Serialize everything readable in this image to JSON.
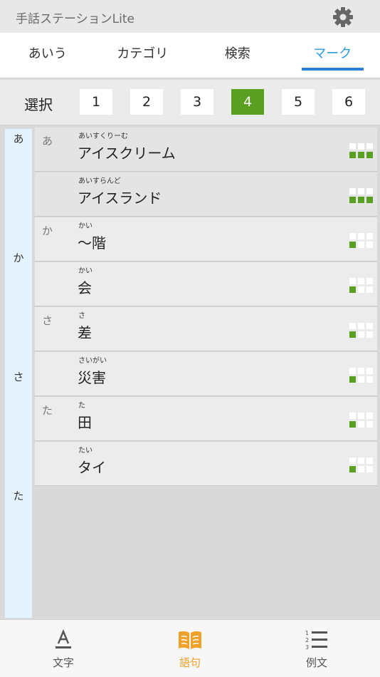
{
  "app": {
    "title": "手話ステーションLite",
    "settings_icon": "gear-icon"
  },
  "tabs": [
    {
      "label": "あいう",
      "active": false
    },
    {
      "label": "カテゴリ",
      "active": false
    },
    {
      "label": "検索",
      "active": false
    },
    {
      "label": "マーク",
      "active": true
    }
  ],
  "selector": {
    "label": "選択",
    "options": [
      "1",
      "2",
      "3",
      "4",
      "5",
      "6"
    ],
    "selected": "4"
  },
  "index": [
    "あ",
    "か",
    "さ",
    "た"
  ],
  "rows": [
    {
      "group": "あ",
      "reading": "あいすくりーむ",
      "word": "アイスクリーム",
      "mark_level": 3
    },
    {
      "group": "",
      "reading": "あいすらんど",
      "word": "アイスランド",
      "mark_level": 3
    },
    {
      "group": "か",
      "reading": "かい",
      "word": "～階",
      "mark_level": 1
    },
    {
      "group": "",
      "reading": "かい",
      "word": "会",
      "mark_level": 1
    },
    {
      "group": "さ",
      "reading": "さ",
      "word": "差",
      "mark_level": 1
    },
    {
      "group": "",
      "reading": "さいがい",
      "word": "災害",
      "mark_level": 1
    },
    {
      "group": "た",
      "reading": "た",
      "word": "田",
      "mark_level": 1
    },
    {
      "group": "",
      "reading": "たい",
      "word": "タイ",
      "mark_level": 1
    }
  ],
  "bottom_nav": [
    {
      "label": "文字",
      "icon": "letter-a-icon",
      "active": false
    },
    {
      "label": "語句",
      "icon": "open-book-icon",
      "active": true
    },
    {
      "label": "例文",
      "icon": "numbered-list-icon",
      "active": false
    }
  ],
  "colors": {
    "accent_blue": "#2b7fd6",
    "mark_green": "#5a9e22",
    "active_orange": "#f0a12a",
    "index_bg": "#e3f2fd"
  }
}
